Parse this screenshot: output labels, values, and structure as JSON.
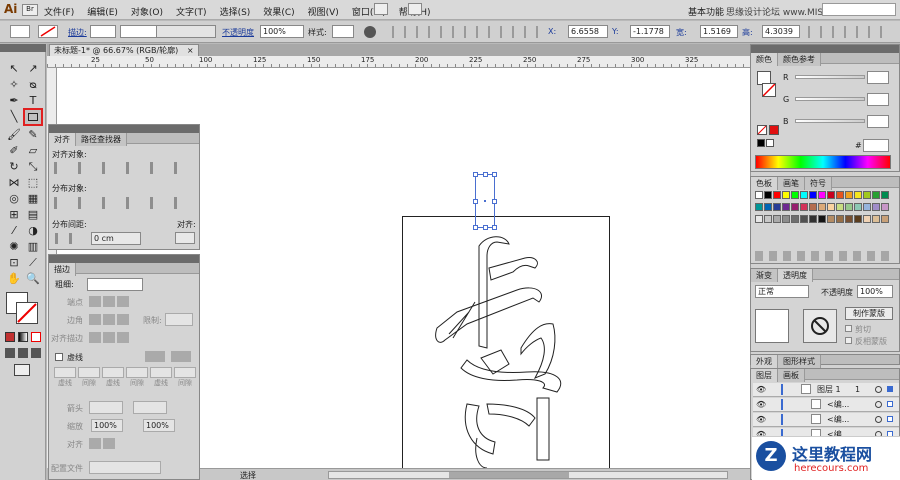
{
  "app": {
    "logo": "Ai",
    "watermark_top": "思缘设计论坛 www.MISSYUAN.COM",
    "workspace": "基本功能"
  },
  "menu": [
    "文件(F)",
    "编辑(E)",
    "对象(O)",
    "文字(T)",
    "选择(S)",
    "效果(C)",
    "视图(V)",
    "窗口(W)",
    "帮助(H)"
  ],
  "control": {
    "stroke_label": "描边:",
    "opacity_label": "不透明度",
    "opacity_value": "100%",
    "style_label": "样式:",
    "x_label": "X:",
    "x_value": "6.6558",
    "y_label": "Y:",
    "y_value": "-1.1778",
    "w_label": "宽:",
    "w_value": "1.5169",
    "h_label": "高:",
    "h_value": "4.3039"
  },
  "doc_tab": {
    "title": "未标题-1* @ 66.67% (RGB/轮廓)",
    "close": "×"
  },
  "ruler_marks": [
    "25",
    "50",
    "100",
    "125",
    "150",
    "175",
    "200",
    "225",
    "250",
    "275",
    "300",
    "325"
  ],
  "align_panel": {
    "tabs": [
      "对齐",
      "路径查找器"
    ],
    "align_objects": "对齐对象:",
    "distribute_objects": "分布对象:",
    "distribute_spacing": "分布间距:",
    "align_to": "对齐:",
    "spacing_value": "0 cm"
  },
  "stroke_panel": {
    "tab": "描边",
    "weight_label": "粗细:",
    "cap_label": "端点",
    "corner_label": "边角",
    "limit_label": "限制:",
    "align_label": "对齐描边",
    "dashed_label": "虚线",
    "dash_cells": [
      "虚线",
      "间隙",
      "虚线",
      "间隙",
      "虚线",
      "间隙"
    ],
    "arrow_label": "箭头",
    "scale_label": "缩放",
    "scale1": "100%",
    "scale2": "100%",
    "align2_label": "对齐",
    "profile_label": "配置文件"
  },
  "color_panel": {
    "tabs": [
      "颜色",
      "颜色参考"
    ],
    "r": "R",
    "g": "G",
    "b": "B",
    "hash": "#"
  },
  "swatches_panel": {
    "tabs": [
      "色板",
      "画笔",
      "符号"
    ],
    "colors": [
      "#ffffff",
      "#000000",
      "#ff0000",
      "#ffff00",
      "#00ff00",
      "#00ffff",
      "#0000ff",
      "#ff00ff",
      "#c8001e",
      "#e6541e",
      "#f0a01e",
      "#f5e61e",
      "#a0c81e",
      "#28a032",
      "#008c50",
      "#009696",
      "#0064b4",
      "#283c96",
      "#6e2891",
      "#961e6e",
      "#d2325a",
      "#b46e50",
      "#dcaa78",
      "#fad2a0",
      "#c8dc82",
      "#96c88c",
      "#8cc8b4",
      "#96b4dc",
      "#a08cc8",
      "#c896c8",
      "#e6e6e6",
      "#c8c8c8",
      "#aaaaaa",
      "#8c8c8c",
      "#6e6e6e",
      "#505050",
      "#323232",
      "#141414",
      "#b48c64",
      "#966e46",
      "#785032",
      "#5a3c1e",
      "#f0d2b4",
      "#dcbe96",
      "#c8a078"
    ]
  },
  "transparency_panel": {
    "tabs": [
      "渐变",
      "透明度"
    ],
    "mode": "正常",
    "opacity_label": "不透明度",
    "opacity_value": "100%",
    "mask_button": "制作蒙版",
    "clip": "剪切",
    "invert": "反相蒙版"
  },
  "layers_panel": {
    "top_tabs": [
      "外观",
      "图形样式"
    ],
    "tabs": [
      "图层",
      "画板"
    ],
    "rows": [
      {
        "name": "图层 1",
        "number": "1"
      },
      {
        "name": "<编...",
        "number": ""
      },
      {
        "name": "<编...",
        "number": ""
      },
      {
        "name": "<编...",
        "number": ""
      }
    ]
  },
  "status": {
    "label": "选择"
  },
  "watermark_bottom": {
    "title": "这里教程网",
    "url": "herecours.com"
  }
}
